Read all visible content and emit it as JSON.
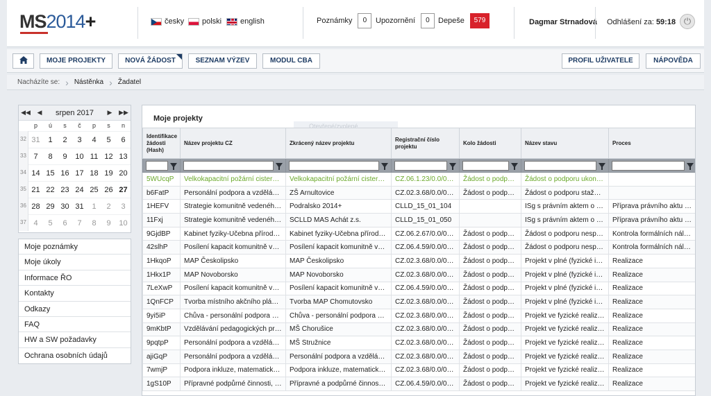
{
  "header": {
    "logo": {
      "ms": "MS",
      "num": "2014",
      "plus": "+"
    },
    "languages": [
      {
        "flag": "cz",
        "label": "česky"
      },
      {
        "flag": "pl",
        "label": "polski"
      },
      {
        "flag": "en",
        "label": "english"
      }
    ],
    "counters": [
      {
        "label": "Poznámky",
        "value": "0"
      },
      {
        "label": "Upozornění",
        "value": "0"
      },
      {
        "label": "Depeše",
        "value": "579",
        "color": "#d8222b"
      }
    ],
    "user": "Dagmar Strnadová",
    "logout_label": "Odhlášení za:",
    "logout_time": "59:18"
  },
  "nav": {
    "items": [
      "MOJE PROJEKTY",
      "NOVÁ ŽÁDOST",
      "SEZNAM VÝZEV",
      "MODUL CBA"
    ],
    "right": [
      "PROFIL UŽIVATELE",
      "NÁPOVĚDA"
    ]
  },
  "breadcrumb": {
    "label": "Nacházíte se:",
    "items": [
      "Nástěnka",
      "Žadatel"
    ]
  },
  "calendar": {
    "title": "srpen 2017",
    "dows": [
      "p",
      "ú",
      "s",
      "č",
      "p",
      "s",
      "n"
    ],
    "weeks": [
      {
        "wk": "32",
        "days": [
          "31",
          "1",
          "2",
          "3",
          "4",
          "5",
          "6"
        ]
      },
      {
        "wk": "33",
        "days": [
          "7",
          "8",
          "9",
          "10",
          "11",
          "12",
          "13"
        ]
      },
      {
        "wk": "34",
        "days": [
          "14",
          "15",
          "16",
          "17",
          "18",
          "19",
          "20"
        ]
      },
      {
        "wk": "35",
        "days": [
          "21",
          "22",
          "23",
          "24",
          "25",
          "26",
          "27"
        ]
      },
      {
        "wk": "36",
        "days": [
          "28",
          "29",
          "30",
          "31",
          "1",
          "2",
          "3"
        ]
      },
      {
        "wk": "37",
        "days": [
          "4",
          "5",
          "6",
          "7",
          "8",
          "9",
          "10"
        ]
      }
    ]
  },
  "sidemenu": [
    "Moje poznámky",
    "Moje úkoly",
    "Informace ŘO",
    "Kontakty",
    "Odkazy",
    "FAQ",
    "HW a SW požadavky",
    "Ochrana osobních údajů"
  ],
  "panel": {
    "title": "Moje projekty",
    "ghost": "Otevřené/zvolené",
    "columns": [
      "Identifikace žádosti (Hash)",
      "Název projektu CZ",
      "Zkrácený název projektu",
      "Registrační číslo projektu",
      "Kolo žádosti",
      "Název stavu",
      "Proces"
    ],
    "rows": [
      [
        "5WUcqP",
        "Velkokapacitní požární cisterna…",
        "Velkokapacitní požární cisterna…",
        "CZ.06.1.23/0.0/0.0…",
        "Žádost o podporu",
        "Žádost o podporu ukonče…",
        ""
      ],
      [
        "b6FatP",
        "Personální podpora a vzdělávání…",
        "ZŠ Arnultovice",
        "CZ.02.3.68/0.0/0.0…",
        "Žádost o podporu",
        "Žádost o podporu stažena…",
        ""
      ],
      [
        "1HEFV",
        "Strategie komunitně vedeného…",
        "Podralsko 2014+",
        "CLLD_15_01_104",
        "",
        "ISg s právním aktem o po…",
        "Příprava právního aktu o p…"
      ],
      [
        "11Fxj",
        "Strategie komunitně vedeného…",
        "SCLLD MAS Achát z.s.",
        "CLLD_15_01_050",
        "",
        "ISg s právním aktem o po…",
        "Příprava právního aktu o p…"
      ],
      [
        "9GjdBP",
        "Kabinet fyziky-Učebna přírodníc…",
        "Kabinet fyziky-Učebna přírodníc…",
        "CZ.06.2.67/0.0/0.0…",
        "Žádost o podporu",
        "Žádost o podporu nesplnil…",
        "Kontrola formálních náleži…"
      ],
      [
        "42slhP",
        "Posílení kapacit komunitně ved…",
        "Posílení kapacit komunitně vede…",
        "CZ.06.4.59/0.0/0.0…",
        "Žádost o podporu",
        "Žádost o podporu nesplnil…",
        "Kontrola formálních náleži…"
      ],
      [
        "1HkqoP",
        "MAP Českolipsko",
        "MAP Českolipsko",
        "CZ.02.3.68/0.0/0.0…",
        "Žádost o podporu",
        "Projekt v plné (fyzické i fi…",
        "Realizace"
      ],
      [
        "1Hkx1P",
        "MAP Novoborsko",
        "MAP Novoborsko",
        "CZ.02.3.68/0.0/0.0…",
        "Žádost o podporu",
        "Projekt v plné (fyzické i fi…",
        "Realizace"
      ],
      [
        "7LeXwP",
        "Posílení kapacit komunitně ved…",
        "Posílení kapacit komunitně vede…",
        "CZ.06.4.59/0.0/0.0…",
        "Žádost o podporu",
        "Projekt v plné (fyzické i fi…",
        "Realizace"
      ],
      [
        "1QnFCP",
        "Tvorba místního akčního plánu r…",
        "Tvorba MAP Chomutovsko",
        "CZ.02.3.68/0.0/0.0…",
        "Žádost o podporu",
        "Projekt v plné (fyzické i fi…",
        "Realizace"
      ],
      [
        "9yi5iP",
        "Chůva - personální podpora MŠ…",
        "Chůva - personální podpora MŠ…",
        "CZ.02.3.68/0.0/0.0…",
        "Žádost o podporu",
        "Projekt ve fyzické realizaci",
        "Realizace"
      ],
      [
        "9mKbtP",
        "Vzdělávání pedagogických praco…",
        "MŠ Chorušice",
        "CZ.02.3.68/0.0/0.0…",
        "Žádost o podporu",
        "Projekt ve fyzické realizaci",
        "Realizace"
      ],
      [
        "9pqtpP",
        "Personální podpora a vzdělávání…",
        "MŠ Stružnice",
        "CZ.02.3.68/0.0/0.0…",
        "Žádost o podporu",
        "Projekt ve fyzické realizaci",
        "Realizace"
      ],
      [
        "ajiGqP",
        "Personální podpora a vzdělávání…",
        "Personální podpora a vzdělávání…",
        "CZ.02.3.68/0.0/0.0…",
        "Žádost o podporu",
        "Projekt ve fyzické realizaci",
        "Realizace"
      ],
      [
        "7wmjP",
        "Podpora inkluze, matematické a…",
        "Podpora inkluze, matematické a…",
        "CZ.02.3.68/0.0/0.0…",
        "Žádost o podporu",
        "Projekt ve fyzické realizaci",
        "Realizace"
      ],
      [
        "1gS10P",
        "Přípravné podpůrné činnosti, pr…",
        "Přípravné a podpůrné činnosti A…",
        "CZ.06.4.59/0.0/0.0…",
        "Žádost o podporu",
        "Projekt ve fyzické realizaci",
        "Realizace"
      ]
    ]
  },
  "colors": {
    "accent": "#1e3c64",
    "badge_red": "#d8222b",
    "green_row": "#6aa82b"
  }
}
